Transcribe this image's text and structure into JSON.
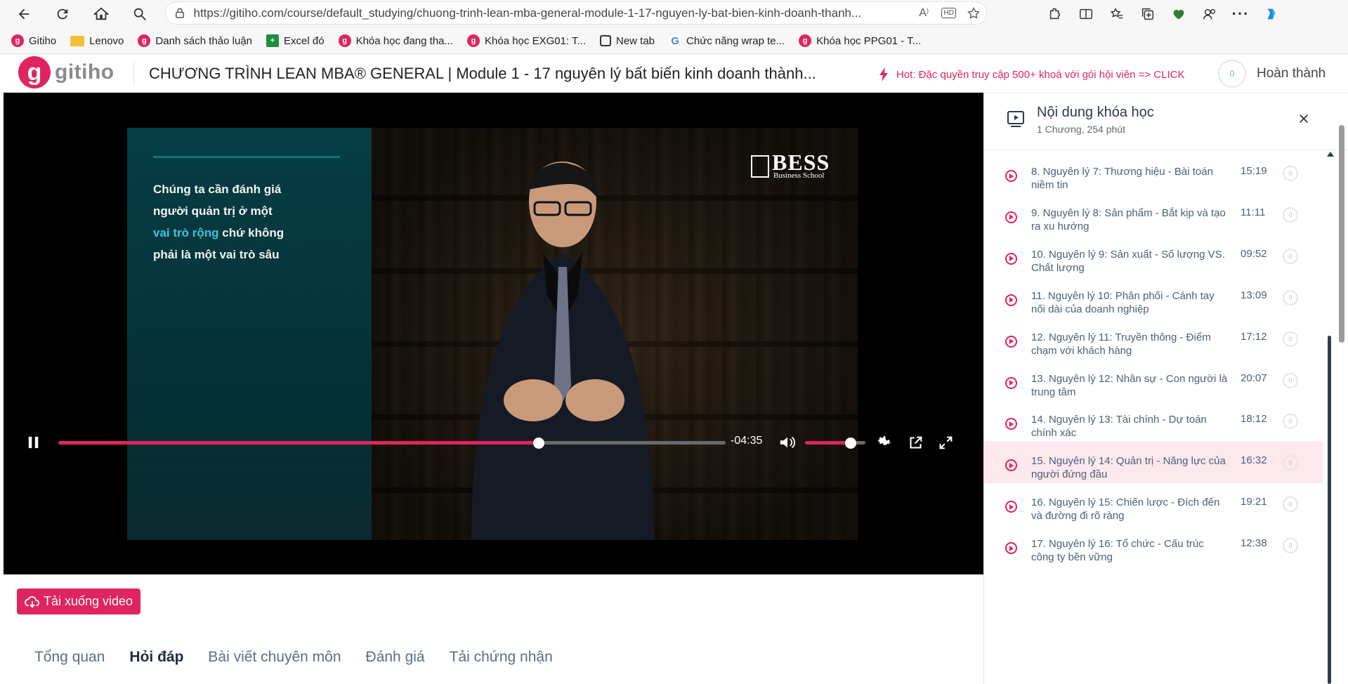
{
  "browser": {
    "url": "https://gitiho.com/course/default_studying/chuong-trinh-lean-mba-general-module-1-17-nguyen-ly-bat-bien-kinh-doanh-thanh...",
    "bookmarks": [
      {
        "label": "Gitiho",
        "icon": "gitiho-favicon"
      },
      {
        "label": "Lenovo",
        "icon": "folder-icon"
      },
      {
        "label": "Danh sách thảo luận",
        "icon": "gitiho-favicon"
      },
      {
        "label": "Excel đó",
        "icon": "excel-icon"
      },
      {
        "label": "Khóa học đang tha...",
        "icon": "gitiho-favicon"
      },
      {
        "label": "Khóa học EXG01: T...",
        "icon": "gitiho-favicon"
      },
      {
        "label": "New tab",
        "icon": "newtab-icon"
      },
      {
        "label": "Chức năng wrap te...",
        "icon": "google-icon"
      },
      {
        "label": "Khóa học PPG01 - T...",
        "icon": "gitiho-favicon"
      }
    ]
  },
  "header": {
    "logo_text": "gitiho",
    "logo_mark": "g",
    "course_title": "CHƯƠNG TRÌNH LEAN MBA® GENERAL | Module 1 - 17 nguyên lý bất biến kinh doanh thành...",
    "hot_text": "Hot: Đặc quyền truy cập 500+ khoá với gói hội viên => CLICK",
    "progress_count": "0",
    "complete_label": "Hoàn thành"
  },
  "video": {
    "quote_line1": "Chúng ta cần đánh giá",
    "quote_line2": "người quản trị ở một",
    "quote_highlight": "vai trò rộng",
    "quote_line3_rest": " chứ không",
    "quote_line4": "phải là một vai trò sâu",
    "brand_main": "BESS",
    "brand_sub": "Business School",
    "time_remaining": "-04:35",
    "progress_fraction": 0.72,
    "volume_fraction": 0.75
  },
  "actions": {
    "download_label": "Tải xuống video"
  },
  "tabs": [
    {
      "label": "Tổng quan",
      "active": false
    },
    {
      "label": "Hỏi đáp",
      "active": true
    },
    {
      "label": "Bài viết chuyên môn",
      "active": false
    },
    {
      "label": "Đánh giá",
      "active": false
    },
    {
      "label": "Tải chứng nhận",
      "active": false
    }
  ],
  "sidebar": {
    "title": "Nội dung khóa học",
    "subtitle": "1 Chương, 254 phút",
    "lessons": [
      {
        "title": "8. Nguyên lý 7: Thương hiệu - Bài toán niềm tin",
        "duration": "15:19",
        "active": false
      },
      {
        "title": "9. Nguyên lý 8: Sản phẩm - Bắt kịp và tạo ra xu hướng",
        "duration": "11:11",
        "active": false
      },
      {
        "title": "10. Nguyên lý 9: Sản xuất - Số lượng VS. Chất lượng",
        "duration": "09:52",
        "active": false
      },
      {
        "title": "11. Nguyên lý 10: Phân phối - Cánh tay nối dài của doanh nghiệp",
        "duration": "13:09",
        "active": false
      },
      {
        "title": "12. Nguyên lý 11: Truyền thông - Điểm chạm với khách hàng",
        "duration": "17:12",
        "active": false
      },
      {
        "title": "13. Nguyên lý 12: Nhân sự - Con người là trung tâm",
        "duration": "20:07",
        "active": false
      },
      {
        "title": "14. Nguyên lý 13: Tài chính - Dự toán chính xác",
        "duration": "18:12",
        "active": false
      },
      {
        "title": "15. Nguyên lý 14: Quản trị - Năng lực của người đứng đầu",
        "duration": "16:32",
        "active": true
      },
      {
        "title": "16. Nguyên lý 15: Chiến lược - Đích đến và đường đi rõ ràng",
        "duration": "19:21",
        "active": false
      },
      {
        "title": "17. Nguyên lý 16: Tổ chức - Cấu trúc công ty bền vững",
        "duration": "12:38",
        "active": false
      }
    ],
    "check_mark": "0"
  },
  "colors": {
    "brand": "#e0245e",
    "panel_teal": "#063d45",
    "highlight_cyan": "#3ec6d8",
    "active_row": "#fde8ee"
  }
}
